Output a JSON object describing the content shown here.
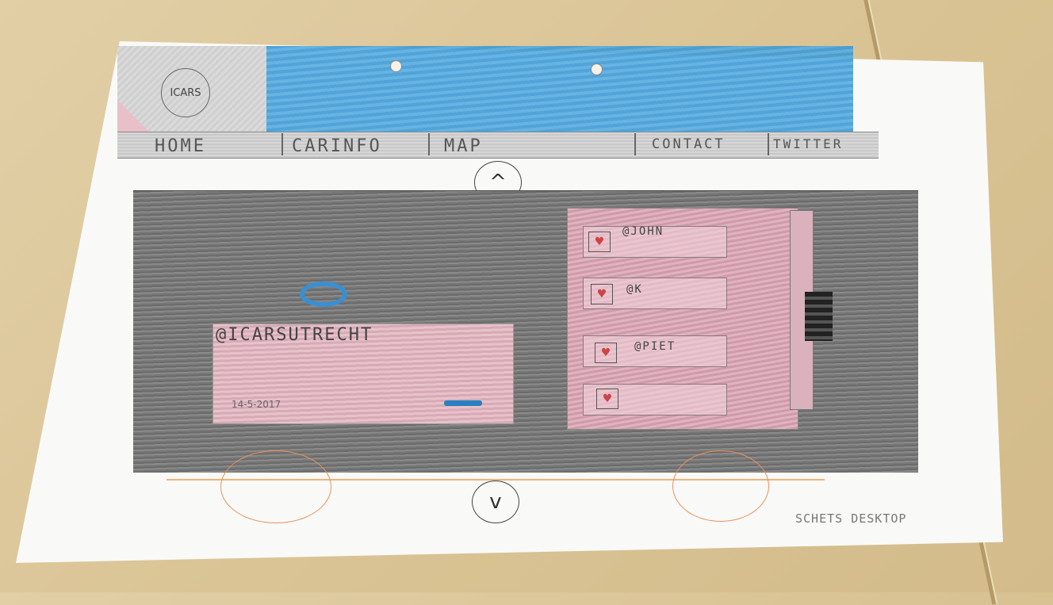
{
  "logo": {
    "text": "ICARS"
  },
  "nav": {
    "items": [
      {
        "label": "HOME"
      },
      {
        "label": "CARINFO"
      },
      {
        "label": "MAP"
      },
      {
        "label": "CONTACT"
      },
      {
        "label": "TWITTER"
      }
    ]
  },
  "carousel": {
    "up_symbol": "^",
    "down_symbol": "v"
  },
  "post": {
    "handle": "@ICARSUTRECHT",
    "date": "14-5-2017"
  },
  "feed": {
    "items": [
      {
        "label": "@JOHN"
      },
      {
        "label": "@K"
      },
      {
        "label": "@PIET"
      },
      {
        "label": ""
      }
    ]
  },
  "caption": "SCHETS DESKTOP",
  "colors": {
    "banner": "#4aa3dc",
    "accent_pink": "#d9a7b4",
    "link_blue": "#2a7fc0",
    "wheel_orange": "#e8915c"
  }
}
